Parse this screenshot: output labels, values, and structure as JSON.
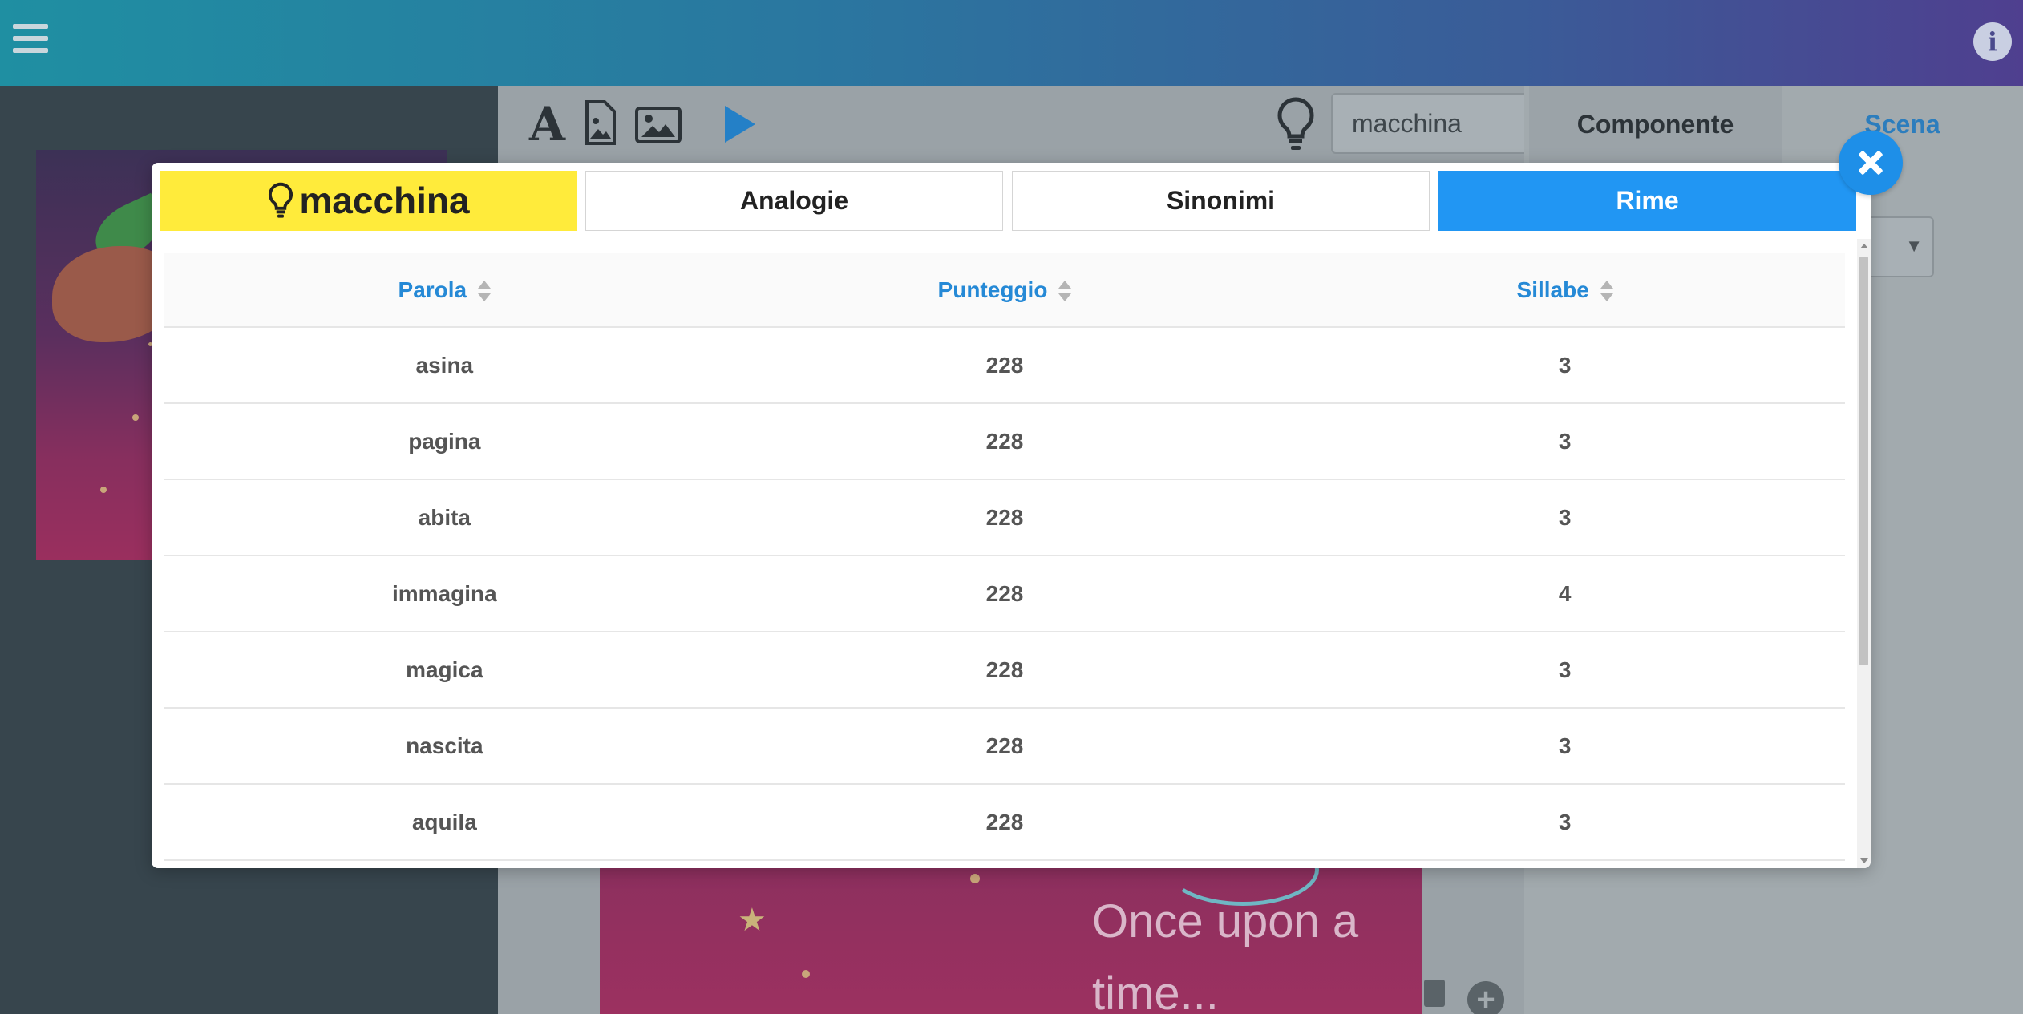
{
  "header": {
    "menu_icon": "hamburger-icon",
    "info_icon": "info-icon",
    "info_glyph": "i"
  },
  "editor": {
    "text_tool_glyph": "A",
    "search_value": "macchina",
    "tab_componente": "Componente",
    "tab_scena": "Scena",
    "scene_text": "Once upon a time...",
    "colors": {
      "accent": "#2196f3",
      "highlight": "#ffeb3b"
    }
  },
  "modal": {
    "tabs": {
      "word": "macchina",
      "analogie": "Analogie",
      "sinonimi": "Sinonimi",
      "rime": "Rime"
    },
    "active_tab": "Rime",
    "columns": {
      "parola": "Parola",
      "punteggio": "Punteggio",
      "sillabe": "Sillabe"
    },
    "rows": [
      {
        "parola": "asina",
        "punteggio": "228",
        "sillabe": "3"
      },
      {
        "parola": "pagina",
        "punteggio": "228",
        "sillabe": "3"
      },
      {
        "parola": "abita",
        "punteggio": "228",
        "sillabe": "3"
      },
      {
        "parola": "immagina",
        "punteggio": "228",
        "sillabe": "4"
      },
      {
        "parola": "magica",
        "punteggio": "228",
        "sillabe": "3"
      },
      {
        "parola": "nascita",
        "punteggio": "228",
        "sillabe": "3"
      },
      {
        "parola": "aquila",
        "punteggio": "228",
        "sillabe": "3"
      }
    ]
  }
}
